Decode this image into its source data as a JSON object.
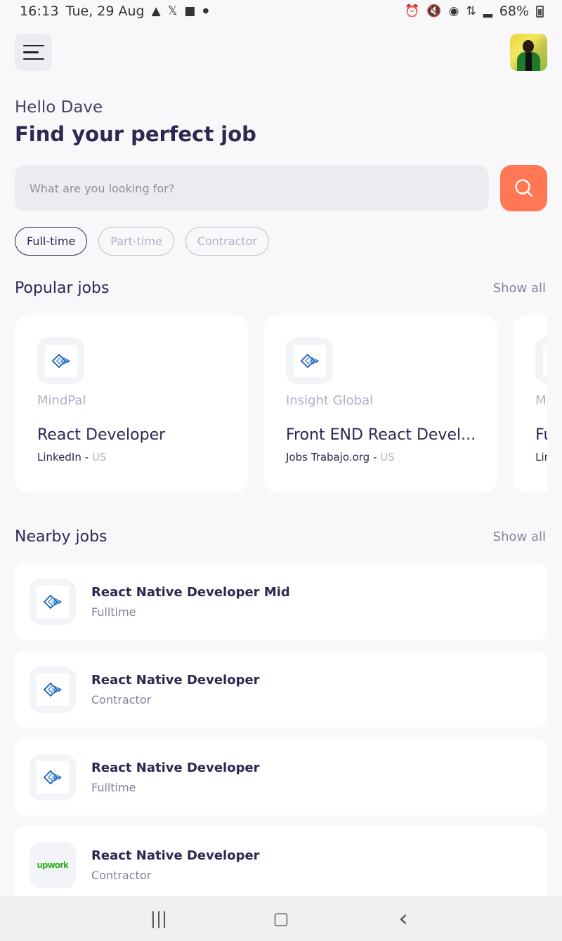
{
  "status_bar": {
    "time": "16:13",
    "date": "Tue, 29 Aug",
    "battery": "68%",
    "left_icons": [
      "notification-a-icon",
      "x-icon",
      "folder-icon",
      "dot-icon"
    ],
    "right_icons": [
      "alarm-icon",
      "mute-icon",
      "hotspot-icon",
      "data-icon",
      "signal-icon",
      "battery-icon"
    ]
  },
  "header": {
    "menu_icon": "menu-icon",
    "avatar": "profile-avatar"
  },
  "welcome": {
    "greeting": "Hello Dave",
    "headline": "Find your perfect job"
  },
  "search": {
    "placeholder": "What are you looking for?",
    "value": "",
    "button_icon": "search-icon"
  },
  "job_types": [
    {
      "label": "Full-time",
      "active": true
    },
    {
      "label": "Part-time",
      "active": false
    },
    {
      "label": "Contractor",
      "active": false
    }
  ],
  "popular": {
    "title": "Popular jobs",
    "show_all": "Show all",
    "jobs": [
      {
        "company": "MindPal",
        "title": "React Developer",
        "publisher": "LinkedIn",
        "sep": " - ",
        "country": "US"
      },
      {
        "company": "Insight Global",
        "title": "Front END React Devel...",
        "publisher": "Jobs Trabajo.org",
        "sep": " - ",
        "country": "US"
      },
      {
        "company": "M",
        "title": "Fu",
        "publisher": "Lin",
        "sep": "",
        "country": ""
      }
    ]
  },
  "nearby": {
    "title": "Nearby jobs",
    "show_all": "Show all",
    "jobs": [
      {
        "title": "React Native Developer Mid",
        "type": "Fulltime",
        "logo": "job-logo"
      },
      {
        "title": "React Native Developer",
        "type": "Contractor",
        "logo": "job-logo"
      },
      {
        "title": "React Native Developer",
        "type": "Fulltime",
        "logo": "job-logo"
      },
      {
        "title": "React Native Developer",
        "type": "Contractor",
        "logo": "upwork",
        "logo_text": "upwork"
      }
    ]
  },
  "nav": {
    "recents": "|||",
    "home": "▢",
    "back": "‹"
  },
  "colors": {
    "accent": "#ff7754",
    "primary": "#312651",
    "gray": "#83829a",
    "background": "#f8f8fb"
  }
}
